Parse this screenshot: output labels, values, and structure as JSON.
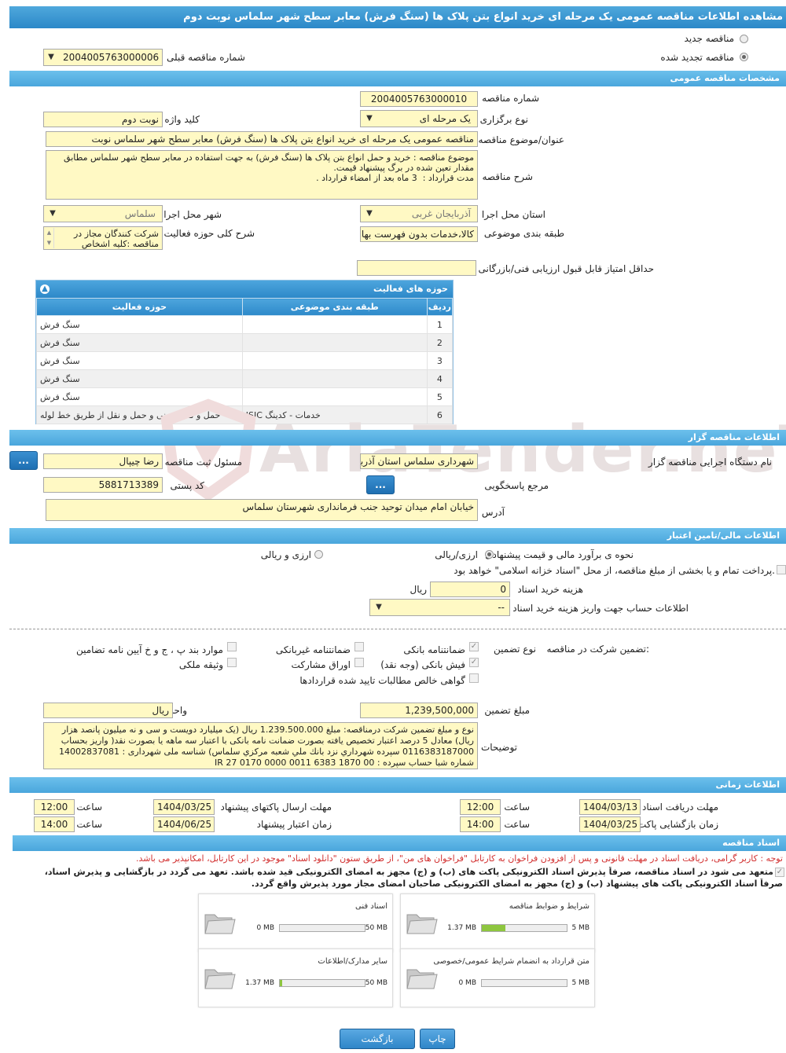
{
  "title": "مشاهده اطلاعات مناقصه عمومی یک مرحله ای خرید انواع بتن پلاک ها (سنگ فرش) معابر سطح شهر سلماس نوبت دوم",
  "tender_type": {
    "new_label": "مناقصه جدید",
    "renewed_label": "مناقصه تجدید شده",
    "previous_number_label": "شماره مناقصه قبلی",
    "previous_number_value": "2004005763000006"
  },
  "sections": {
    "general": "مشخصات مناقصه عمومی",
    "organizer": "اطلاعات مناقصه گزار",
    "financial": "اطلاعات مالی/تامین اعتبار",
    "timing": "اطلاعات زمانی",
    "documents": "اسناد مناقصه"
  },
  "general": {
    "number_label": "شماره مناقصه",
    "number_value": "2004005763000010",
    "holding_type_label": "نوع برگزاری",
    "holding_type_value": "یک مرحله ای",
    "keyword_label": "کلید واژه",
    "keyword_value": "نوبت دوم",
    "subject_label": "عنوان/موضوع مناقصه",
    "subject_value": "مناقصه عمومی یک مرحله ای  خرید انواع بتن پلاک ها (سنگ فرش) معابر سطح شهر سلماس نوبت",
    "description_label": "شرح مناقصه",
    "description_value": "موضوع مناقصه : خرید و حمل انواع بتن پلاک ها (سنگ فرش) به جهت استفاده در معابر سطح شهر سلماس مطابق مقدار تعین شده در برگ پیشنهاد قیمت.\nمدت قرارداد :  3 ماه بعد از امضاء قرارداد .",
    "province_label": "استان محل اجرا",
    "province_value": "آذربایجان غربی",
    "city_label": "شهر محل اجرا",
    "city_value": "سلماس",
    "category_label": "طبقه بندی موضوعی",
    "category_value": "کالا،خدمات بدون فهرست بها",
    "scope_label": "شرح کلی حوزه فعالیت",
    "scope_value": "شرکت کنندگان مجاز در مناقصه :کلیه اشخاص",
    "min_score_label": "حداقل امتیاز قابل قبول ارزیابی فنی/بازرگانی",
    "min_score_value": ""
  },
  "activity_table": {
    "title": "حوزه های فعالیت",
    "headers": [
      "ردیف",
      "طبقه بندی موضوعی",
      "حوزه فعالیت"
    ],
    "rows": [
      {
        "idx": "1",
        "category": "",
        "activity": "سنگ فرش"
      },
      {
        "idx": "2",
        "category": "",
        "activity": "سنگ فرش"
      },
      {
        "idx": "3",
        "category": "",
        "activity": "سنگ فرش"
      },
      {
        "idx": "4",
        "category": "",
        "activity": "سنگ فرش"
      },
      {
        "idx": "5",
        "category": "",
        "activity": "سنگ فرش"
      },
      {
        "idx": "6",
        "category": "خدمات - کدینگ ISIC",
        "activity": "حمل و نقل زمینی و حمل و نقل از طریق خط لوله"
      }
    ]
  },
  "organizer": {
    "org_label": "نام دستگاه اجرایی مناقصه گزار",
    "org_value": "شهرداری سلماس استان آذربایجان غربی",
    "registrar_label": "مسئول ثبت مناقصه",
    "registrar_value": "رضا چیپال",
    "more_button": "...",
    "reference_label": "مرجع پاسخگویی",
    "reference_button": "...",
    "postal_label": "کد پستی",
    "postal_value": "5881713389",
    "address_label": "آدرس",
    "address_value": "خیابان امام میدان توحید جنب فرمانداری شهرستان سلماس"
  },
  "financial": {
    "estimate_label": "نحوه ی برآورد مالی و قیمت پیشنهادی",
    "option_rial": "ارزی/ریالی",
    "option_fx": "ارزی و ریالی",
    "treasury_text": "پرداخت تمام و یا بخشی از مبلغ مناقصه، از محل \"اسناد خزانه اسلامی\" خواهد بود.",
    "doc_fee_label": "هزینه خرید اسناد",
    "doc_fee_value": "0",
    "doc_fee_unit": "ریال",
    "account_label": "اطلاعات حساب جهت واریز هزینه خرید اسناد",
    "account_value": "--"
  },
  "guarantee": {
    "section_label": "تضمین شرکت در مناقصه:",
    "type_label": "نوع تضمین",
    "options": {
      "bank_guarantee": "ضمانتنامه بانکی",
      "non_bank_guarantee": "ضمانتنامه غیربانکی",
      "other_items": "موارد بند پ ، ج و خ آیین نامه تضامین",
      "bank_receipt": "فیش بانکی (وجه نقد)",
      "securities": "اوراق مشارکت",
      "property": "وثیقه ملکی",
      "claims_certificate": "گواهی خالص مطالبات تایید شده قراردادها"
    },
    "amount_label": "مبلغ تضمین",
    "amount_value": "1,239,500,000",
    "currency_label": "واحد پول",
    "currency_value": "ریال",
    "notes_label": "توضیحات",
    "notes_value": "نوع و مبلغ تضمین شرکت درمناقصه: مبلغ 1.239.500.000 ریال (یک میلیارد دویست و سی و نه میلیون پانصد هزار ریال) معادل 5 درصد اعتبار تخصیص یافته بصورت ضمانت نامه بانکی با اعتبار سه ماهه یا بصورت نقد( واریز بحساب 0116383187000 سپرده شهرداري نزد بانك ملي شعبه مركزي سلماس) شناسه ملی شهرداری : 14002837081  شماره شبا حساب سپرده : IR 27 0170 0000 0011 6383 1870 00"
  },
  "timing": {
    "doc_receive_label": "مهلت دریافت اسناد",
    "doc_receive_date": "1404/03/13",
    "doc_receive_time": "12:00",
    "send_label": "مهلت ارسال پاکتهای پیشنهاد",
    "send_date": "1404/03/25",
    "send_time": "12:00",
    "open_label": "زمان بازگشایی پاکت ها",
    "open_date": "1404/03/25",
    "open_time": "14:00",
    "validity_label": "زمان اعتبار پیشنهاد",
    "validity_date": "1404/06/25",
    "validity_time": "14:00",
    "time_label": "ساعت"
  },
  "documents": {
    "notice": "توجه : کاربر گرامی، دریافت اسناد در مهلت قانونی و پس از افزودن فراخوان به کارتابل \"فراخوان های من\"، از طریق ستون \"دانلود اسناد\" موجود در این کارتابل، امکانپذیر می باشد.",
    "commitment_1": "متعهد می شود در اسناد مناقصه، صرفاً پذیرش اسناد الکترونیکی پاکت های (ب) و (ج) مجهز به امضای الکترونیکی قید شده باشد. تعهد می گردد در بازگشایی و پذیرش اسناد،",
    "commitment_2": "صرفاً اسناد الکترونیکی پاکت های پیشنهاد (ب) و (ج) مجهز به امضای الکترونیکی صاحبان امضای مجاز مورد پذیرش واقع گردد.",
    "boxes": [
      {
        "name": "شرایط و ضوابط مناقصه",
        "used": "1.37 MB",
        "max": "5 MB",
        "ratio": 0.274
      },
      {
        "name": "اسناد فنی",
        "used": "0 MB",
        "max": "50 MB",
        "ratio": 0
      },
      {
        "name": "متن قرارداد به انضمام شرایط عمومی/خصوصی",
        "used": "0 MB",
        "max": "5 MB",
        "ratio": 0
      },
      {
        "name": "سایر مدارک/اطلاعات",
        "used": "1.37 MB",
        "max": "50 MB",
        "ratio": 0.027
      }
    ]
  },
  "buttons": {
    "print": "چاپ",
    "back": "بازگشت"
  },
  "watermark": "AriaTender.neT"
}
